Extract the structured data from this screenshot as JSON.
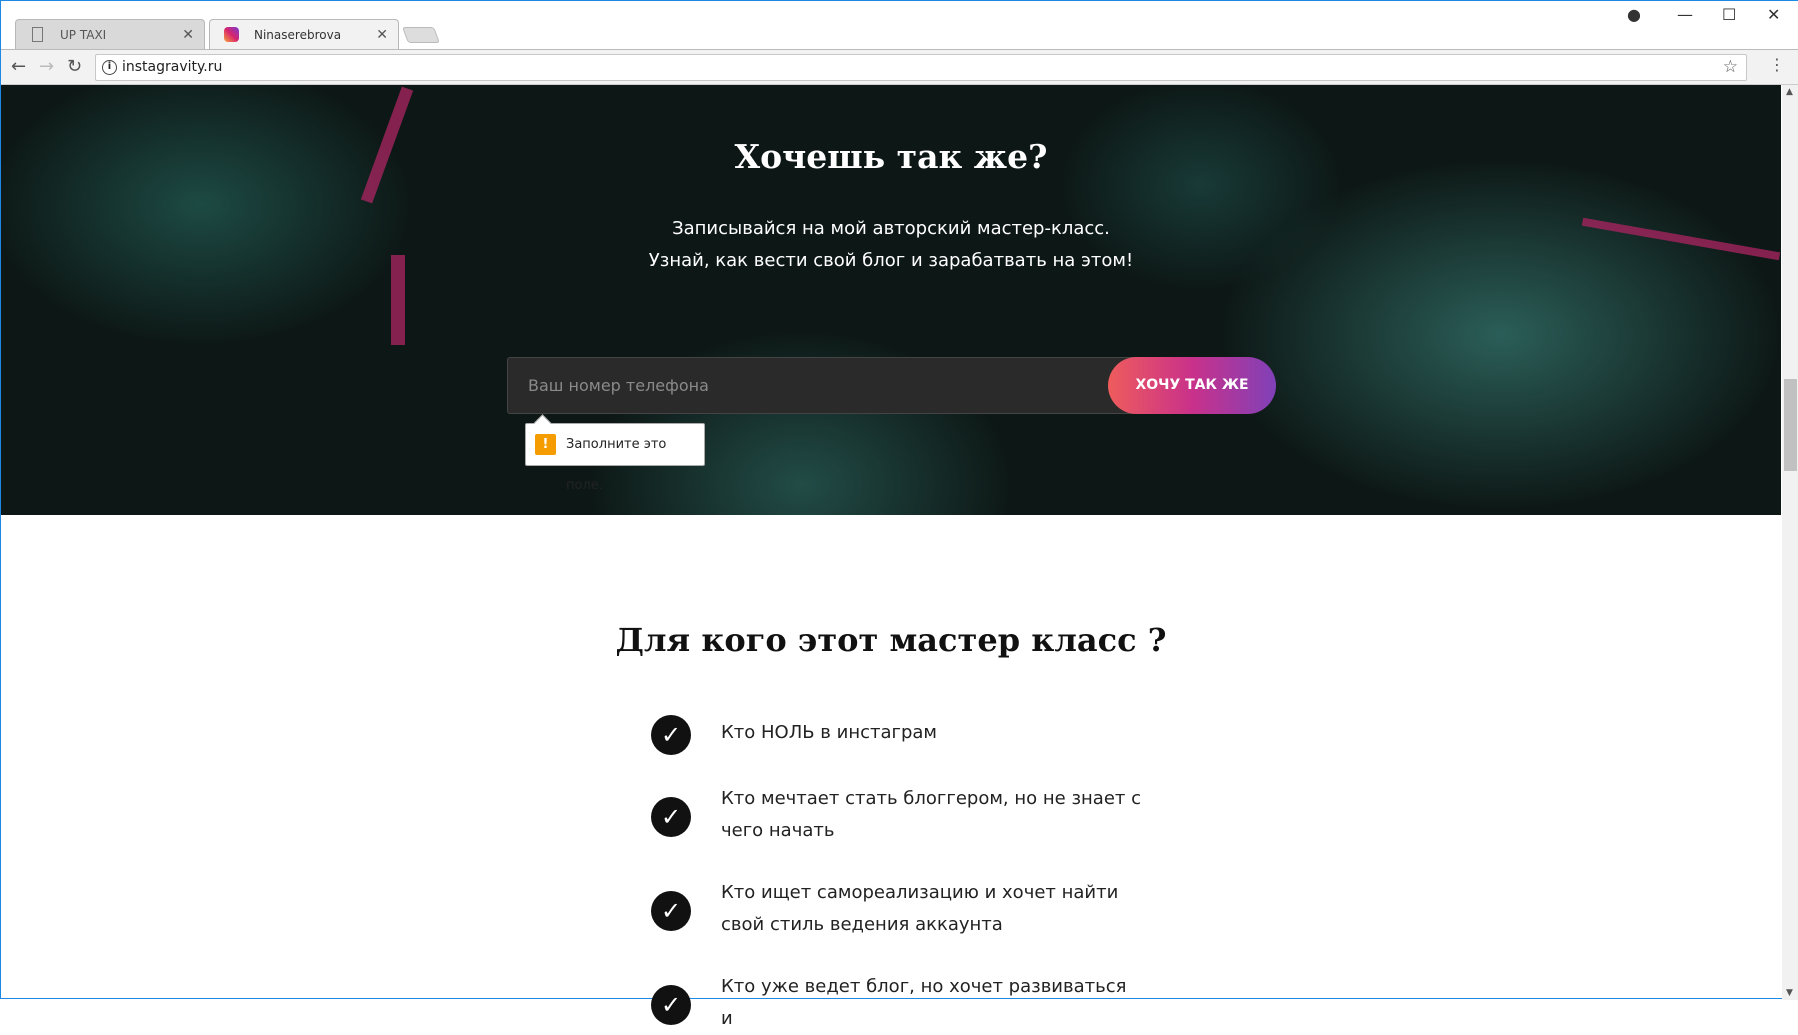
{
  "browser": {
    "tabs": [
      {
        "title": "UP TAXI",
        "active": false
      },
      {
        "title": "Ninaserebrova",
        "active": true
      }
    ],
    "url": "instagravity.ru"
  },
  "hero": {
    "title": "Хочешь так же?",
    "subtitle_line1": "Записывайся на мой авторский мастер-класс.",
    "subtitle_line2": "Узнай, как вести свой блог и зарабатвать на этом!",
    "phone_placeholder": "Ваш номер телефона",
    "cta_label": "ХОЧУ ТАК ЖЕ",
    "validation_tooltip": "Заполните это поле."
  },
  "audience": {
    "title": "Для кого этот мастер класс ?",
    "items": [
      "Кто НОЛЬ в инстаграм",
      "Кто мечтает стать блоггером, но не знает с чего начать",
      "Кто ищет самореализацию и хочет найти свой стиль ведения аккаунта",
      "Кто уже ведет блог, но хочет развиваться и"
    ]
  },
  "colors": {
    "cta_start": "#ee5c5c",
    "cta_end": "#8041b8",
    "warning": "#f59d00"
  }
}
